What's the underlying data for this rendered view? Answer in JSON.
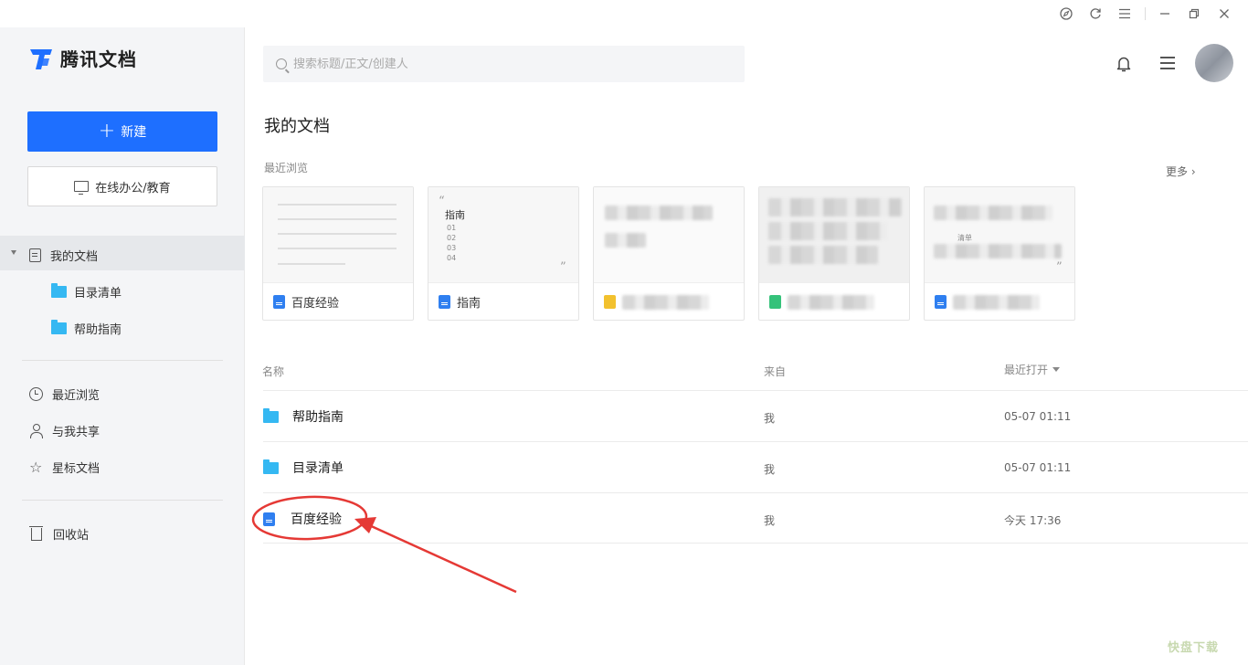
{
  "app": {
    "name": "腾讯文档"
  },
  "sidebar": {
    "new_button": "新建",
    "edu_button": "在线办公/教育",
    "my_docs": "我的文档",
    "folders": [
      {
        "label": "目录清单"
      },
      {
        "label": "帮助指南"
      }
    ],
    "nav": [
      {
        "label": "最近浏览",
        "icon": "clock-icon"
      },
      {
        "label": "与我共享",
        "icon": "user-icon"
      },
      {
        "label": "星标文档",
        "icon": "star-icon"
      }
    ],
    "trash": "回收站"
  },
  "search": {
    "placeholder": "搜索标题/正文/创建人",
    "value": ""
  },
  "main": {
    "title": "我的文档",
    "recent_label": "最近浏览",
    "more_label": "更多 ›",
    "recent_cards": [
      {
        "name": "百度经验",
        "type": "doc"
      },
      {
        "name": "指南",
        "type": "doc",
        "thumb_title": "指南",
        "thumb_items": [
          "01",
          "02",
          "03",
          "04"
        ]
      },
      {
        "name": "",
        "type": "sheet"
      },
      {
        "name": "",
        "type": "slide"
      },
      {
        "name": "",
        "type": "doc",
        "thumb_text": "清单"
      }
    ],
    "list_headers": {
      "name": "名称",
      "from": "来自",
      "opened": "最近打开"
    },
    "rows": [
      {
        "name": "帮助指南",
        "type": "folder",
        "from": "我",
        "opened": "05-07 01:11"
      },
      {
        "name": "目录清单",
        "type": "folder",
        "from": "我",
        "opened": "05-07 01:11"
      },
      {
        "name": "百度经验",
        "type": "doc",
        "from": "我",
        "opened": "今天 17:36"
      }
    ]
  },
  "colors": {
    "accent": "#1e6fff",
    "folder": "#35b8f2",
    "doc": "#2f7ff0",
    "annotation": "#e53935"
  },
  "watermark": "快盘下载"
}
